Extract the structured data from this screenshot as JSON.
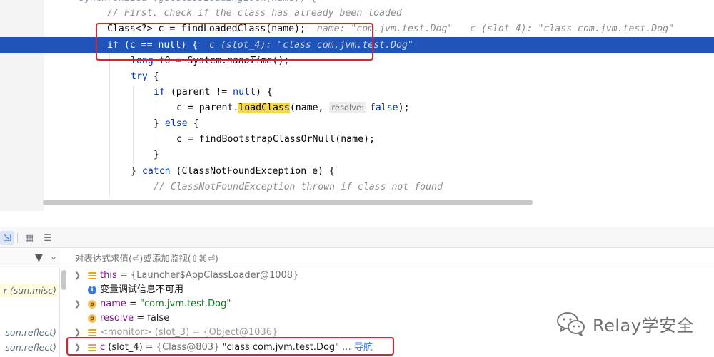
{
  "editor": {
    "lines": {
      "comment_first": "// First, check if the class has already been loaded",
      "find_loaded": "Class<?> c = findLoadedClass(name);",
      "find_loaded_hint_name": "name: \"com.jvm.test.Dog\"",
      "find_loaded_hint_c": "c (slot_4): \"class com.jvm.test.Dog\"",
      "if_kw": "if",
      "if_rest": " (c == ",
      "null_kw": "null",
      "if_close": ") {",
      "if_hint": "c (slot_4): \"class com.jvm.test.Dog\"",
      "long_kw": "long",
      "long_rest": " t0 = System.",
      "nanotime": "nanoTime",
      "long_end": "();",
      "try_kw": "try",
      "try_rest": " {",
      "parent_if_rest": " (parent != ",
      "parent_if_close": ") {",
      "assign_parent": "c = parent.",
      "load_class": "loadClass",
      "load_args_open": "(name, ",
      "resolve_hint": "resolve:",
      "false_kw": "false",
      "load_args_close": ");",
      "else_open": "} ",
      "else_kw": "else",
      "else_close": " {",
      "bootstrap": "c = findBootstrapClassOrNull(name);",
      "close_brace": "}",
      "catch_open": "} ",
      "catch_kw": "catch",
      "catch_rest": " (ClassNotFoundException e) {",
      "comment_cnfe": "// ClassNotFoundException thrown if class not found"
    }
  },
  "toolbar": {
    "icons": [
      "step-cursor-icon",
      "table-view-icon",
      "restore-layout-icon"
    ]
  },
  "frames": {
    "items": [
      {
        "label": "r (sun.misc)"
      },
      {
        "label": "sun.reflect)"
      },
      {
        "label": "sun.reflect)"
      }
    ]
  },
  "variables": {
    "eval_placeholder": "对表达式求值(⏎)或添加监视(⇧⌘⏎)",
    "rows": [
      {
        "name": "this",
        "eq": " = ",
        "value": "{Launcher$AppClassLoader@1008}"
      },
      {
        "message": "变量调试信息不可用"
      },
      {
        "name": "name",
        "eq": " = ",
        "value": "\"com.jvm.test.Dog\""
      },
      {
        "name": "resolve",
        "eq": " = ",
        "value": "false"
      },
      {
        "name": "<monitor>",
        "eq": " (slot_3) = ",
        "value": "{Object@1036}"
      },
      {
        "name": "c",
        "eq": " (slot_4) = ",
        "value_ref": "{Class@803}",
        "value": " \"class com.jvm.test.Dog\"",
        "link": " ... 导航"
      }
    ]
  },
  "watermark": {
    "text": "Relay学安全"
  },
  "colors": {
    "execution_line": "#2154b9",
    "highlight_red": "#e0202a",
    "keyword": "#0033b3",
    "string": "#067d17",
    "search_highlight": "#f5d847"
  }
}
